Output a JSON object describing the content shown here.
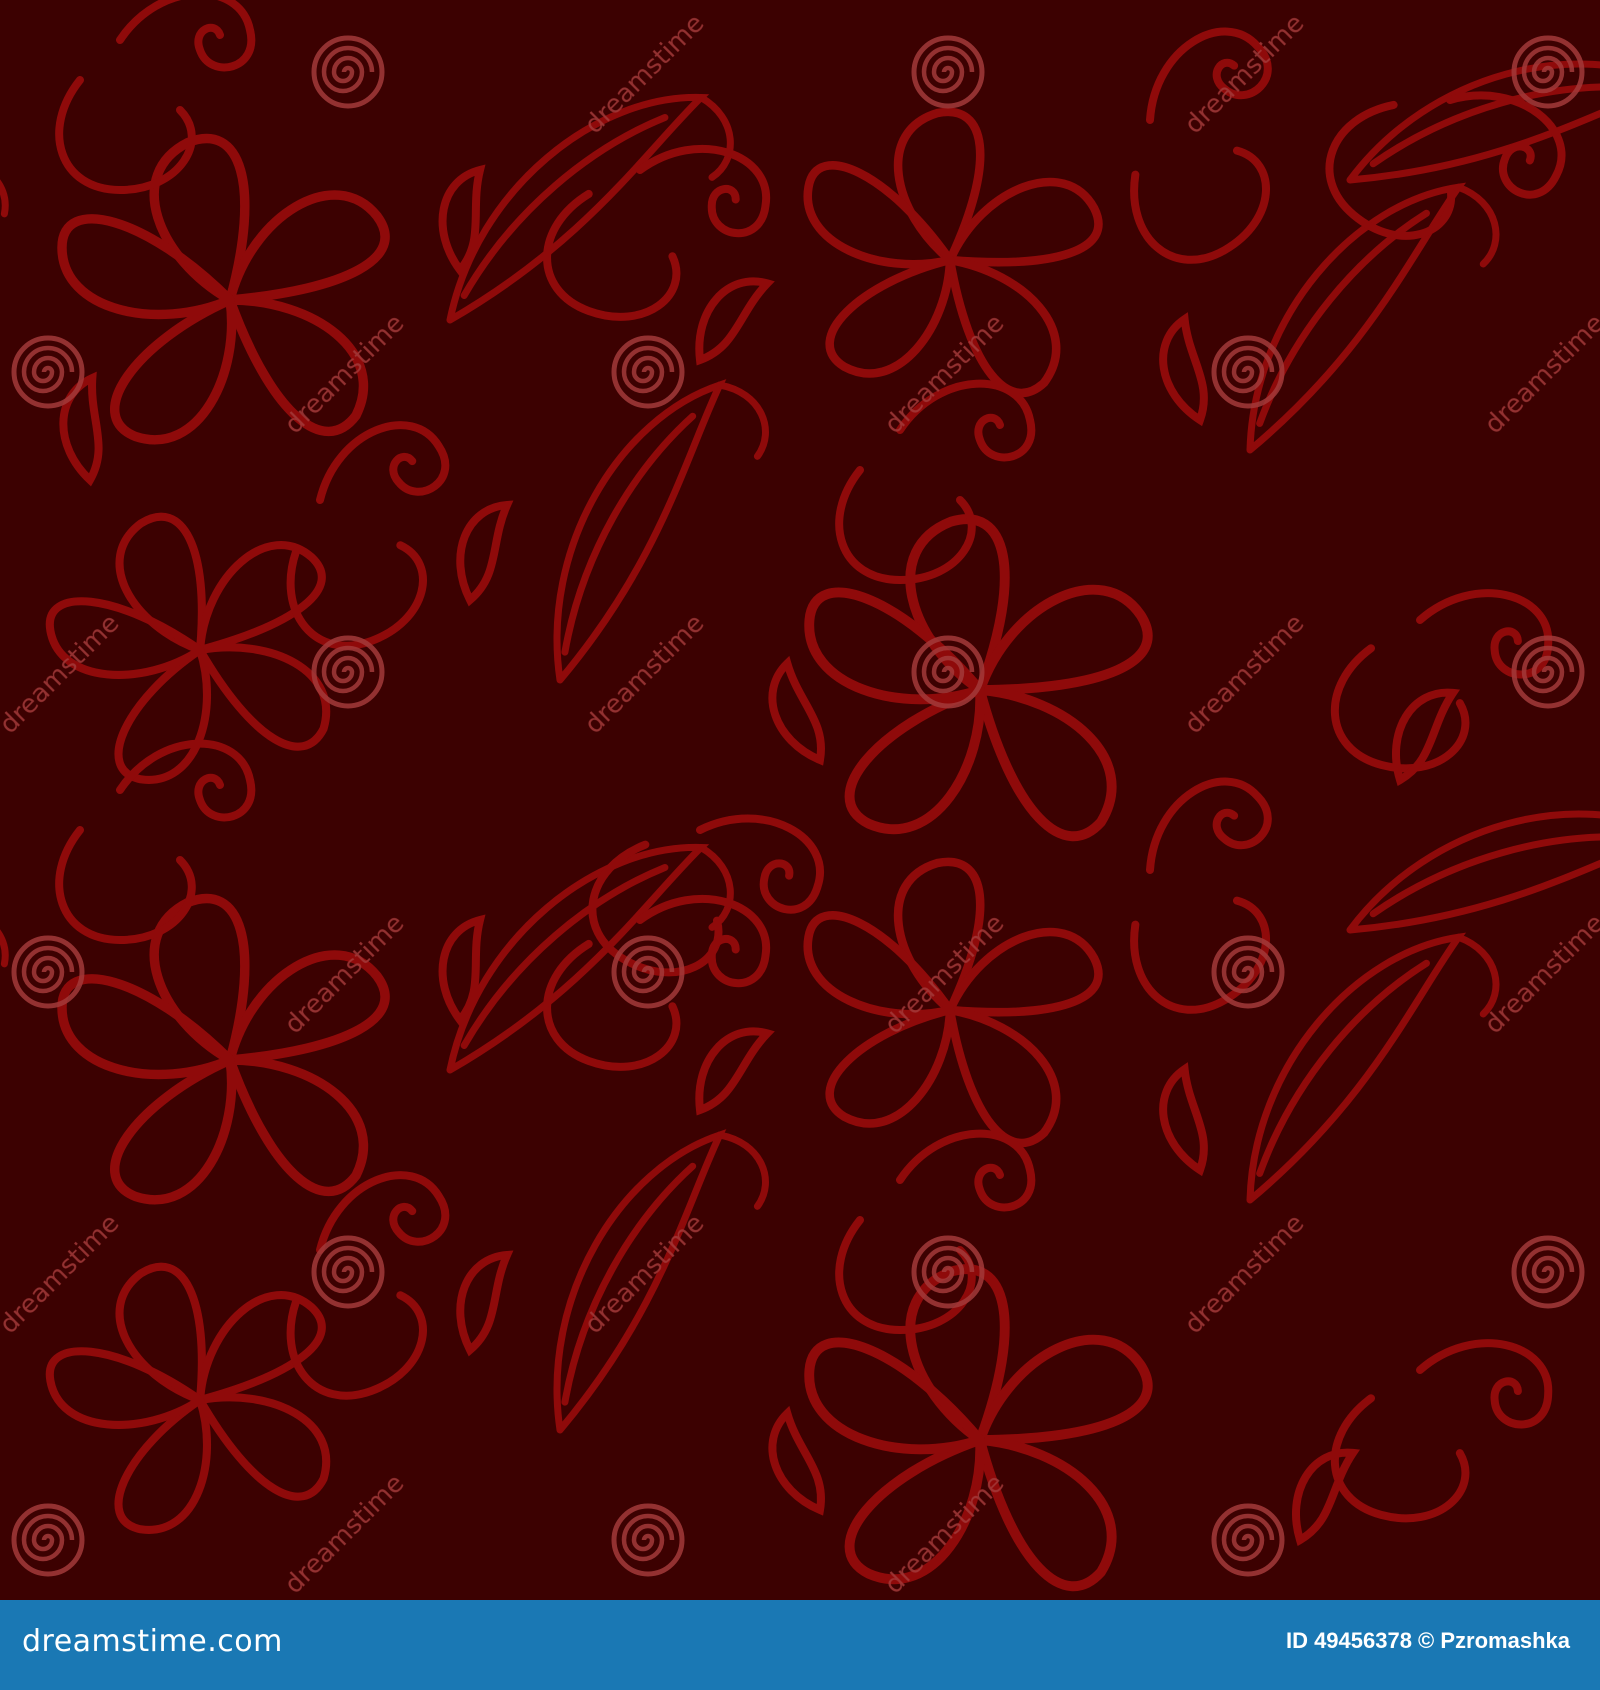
{
  "image": {
    "background_color": "#3c0101",
    "pattern_color": "#8f0a0a",
    "pattern_subject": "seamless floral swirl pattern: five-petal flowers, curling leaves and teardrop droplets",
    "watermark_text": "dreamstime",
    "watermark_icon": "spiral-icon"
  },
  "footer": {
    "background_color": "#1a78b4",
    "brand": "dreamstime.com",
    "id_text": "ID 49456378 © Pzromashka"
  }
}
